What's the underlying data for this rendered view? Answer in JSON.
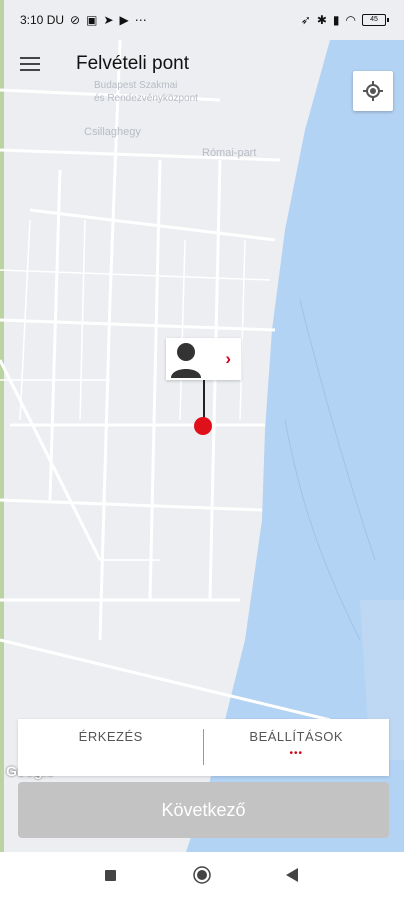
{
  "status_bar": {
    "time": "3:10 DU",
    "notification_icons": [
      "alarm-off-icon",
      "sim-icon",
      "telegram-icon",
      "youtube-icon",
      "more-dots-icon"
    ],
    "right_icons": [
      "location-icon",
      "bluetooth-icon",
      "signal-icon",
      "wifi-icon"
    ],
    "battery": "45"
  },
  "header": {
    "title": "Felvételi pont"
  },
  "map": {
    "labels": {
      "area_label_1": "Budapest Szakmai",
      "area_label_2": "és Rendezvényközpont",
      "area_label_3": "Csillaghegy",
      "area_label_4": "Római-part"
    },
    "attribution": "Google",
    "colors": {
      "land": "#eceef1",
      "road": "#ffffff",
      "water": "#b3d3f4",
      "pin": "#e0101a",
      "accent": "#d0021b"
    }
  },
  "pickup_pin": {
    "icon": "person-icon",
    "chevron": "›"
  },
  "tabs": [
    {
      "label": "ÉRKEZÉS"
    },
    {
      "label": "BEÁLLÍTÁSOK",
      "indicator": "•••"
    }
  ],
  "next_button": {
    "label": "Következő"
  }
}
